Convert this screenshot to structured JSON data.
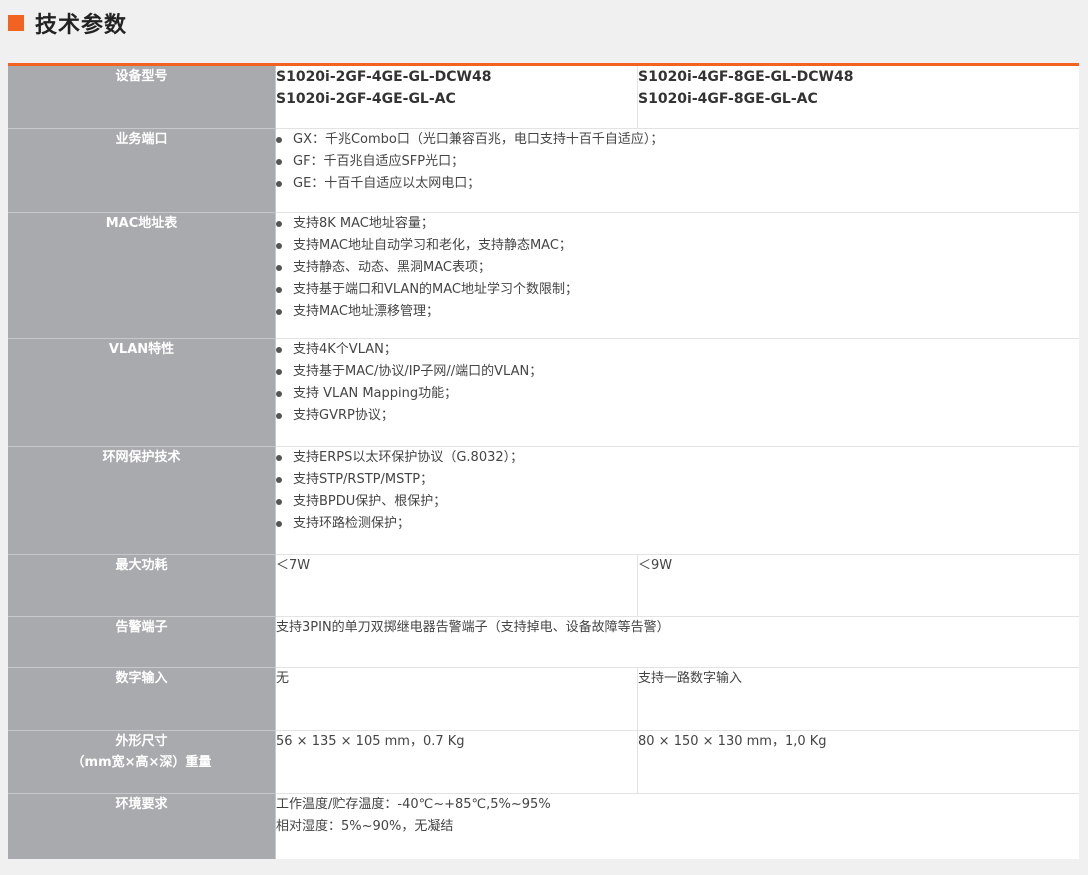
{
  "page": {
    "title": "技术参数",
    "accent": "#f26322"
  },
  "rows": {
    "model": {
      "label": "设备型号",
      "col1": [
        "S1020i-2GF-4GE-GL-DCW48",
        "S1020i-2GF-4GE-GL-AC"
      ],
      "col2": [
        "S1020i-4GF-8GE-GL-DCW48",
        "S1020i-4GF-8GE-GL-AC"
      ]
    },
    "ports": {
      "label": "业务端口",
      "items": [
        "GX：千兆Combo口（光口兼容百兆，电口支持十百千自适应）；",
        "GF：千百兆自适应SFP光口；",
        "GE：十百千自适应以太网电口；"
      ]
    },
    "mac": {
      "label": "MAC地址表",
      "items": [
        "支持8K MAC地址容量；",
        "支持MAC地址自动学习和老化，支持静态MAC；",
        "支持静态、动态、黑洞MAC表项；",
        "支持基于端口和VLAN的MAC地址学习个数限制；",
        "支持MAC地址漂移管理；"
      ]
    },
    "vlan": {
      "label": "VLAN特性",
      "items": [
        "支持4K个VLAN；",
        "支持基于MAC/协议/IP子网//端口的VLAN；",
        "支持 VLAN Mapping功能；",
        "支持GVRP协议；"
      ]
    },
    "ring": {
      "label": "环网保护技术",
      "items": [
        "支持ERPS以太环保护协议（G.8032）；",
        "支持STP/RSTP/MSTP；",
        "支持BPDU保护、根保护；",
        "支持环路检测保护；"
      ]
    },
    "power": {
      "label": "最大功耗",
      "col1": "＜7W",
      "col2": "＜9W"
    },
    "alarm": {
      "label": "告警端子",
      "value": "支持3PIN的单刀双掷继电器告警端子（支持掉电、设备故障等告警）"
    },
    "digital": {
      "label": "数字输入",
      "col1": "无",
      "col2": "支持一路数字输入"
    },
    "size": {
      "label_line1": "外形尺寸",
      "label_line2": "（mm宽×高×深）重量",
      "col1": "56 × 135 × 105 mm，0.7 Kg",
      "col2": "80 × 150 × 130 mm，1,0 Kg"
    },
    "env": {
      "label": "环境要求",
      "line1": "工作温度/贮存温度：-40℃~+85℃,5%~95%",
      "line2": "相对湿度：5%~90%，无凝结"
    }
  }
}
